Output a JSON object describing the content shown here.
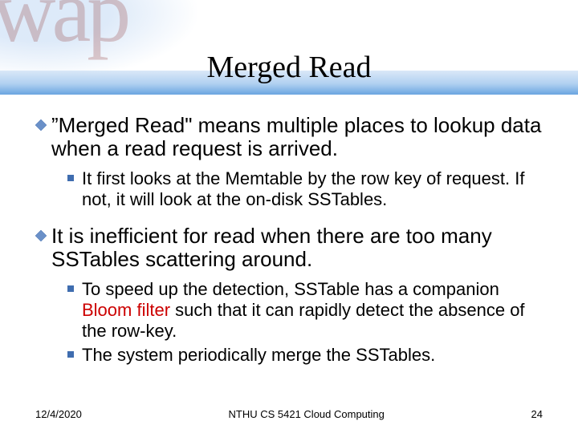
{
  "background": {
    "letters": "wap"
  },
  "title": "Merged Read",
  "bullets": [
    {
      "text": "”Merged Read\" means multiple places to lookup data when a read request is arrived.",
      "subs": [
        {
          "text": "It first looks at the Memtable by the row key of request. If not, it will look at the on-disk SSTables."
        }
      ]
    },
    {
      "text": "It is inefficient for read when there are too many SSTables scattering around.",
      "subs": [
        {
          "prefix": "To speed up the detection, SSTable has a companion ",
          "red": "Bloom filter",
          "suffix": " such that it can rapidly detect the absence of the row-key."
        },
        {
          "text": "The system periodically merge the SSTables."
        }
      ]
    }
  ],
  "footer": {
    "date": "12/4/2020",
    "center": "NTHU CS 5421 Cloud Computing",
    "page": "24"
  },
  "colors": {
    "accent_blue": "#3f6daf",
    "red": "#cc0000"
  }
}
